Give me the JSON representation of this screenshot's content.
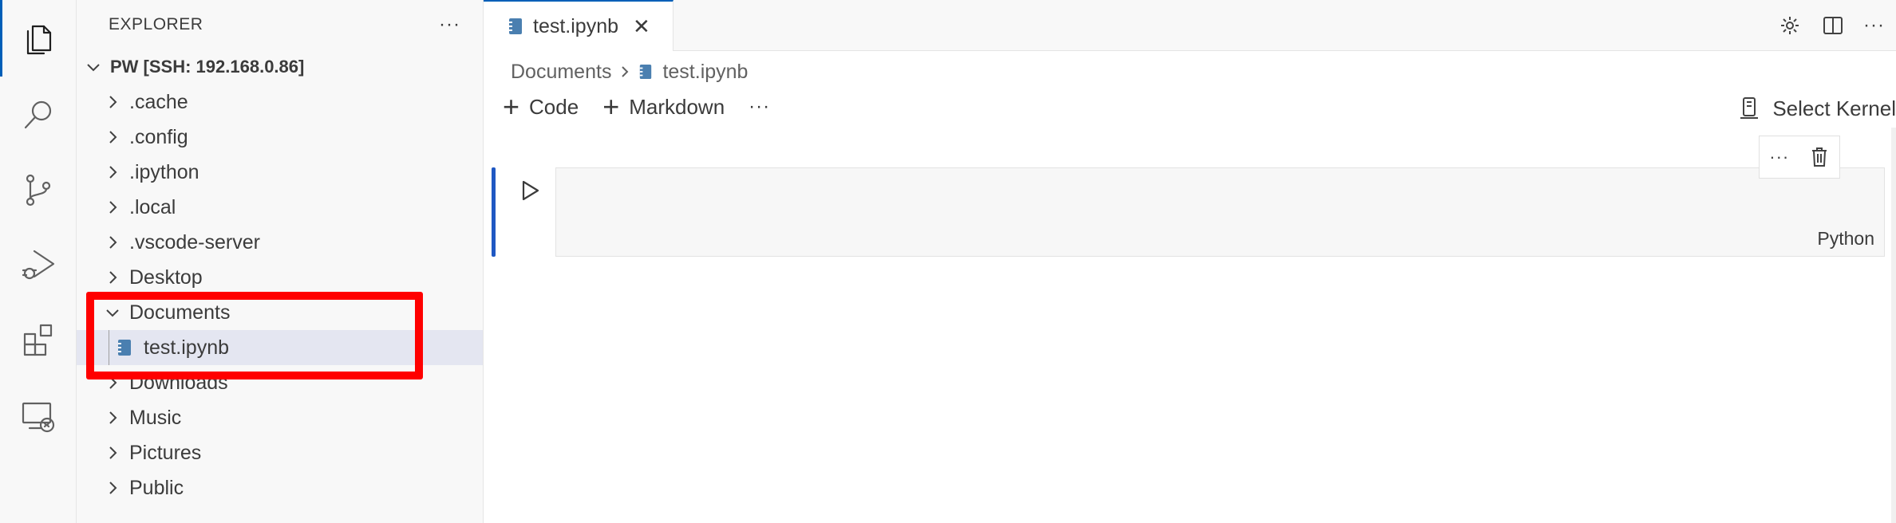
{
  "activity_bar": {
    "items": [
      {
        "icon": "files-icon",
        "active": true
      },
      {
        "icon": "search-icon",
        "active": false
      },
      {
        "icon": "source-control-icon",
        "active": false
      },
      {
        "icon": "run-debug-icon",
        "active": false
      },
      {
        "icon": "extensions-icon",
        "active": false
      },
      {
        "icon": "remote-explorer-icon",
        "active": false
      }
    ]
  },
  "sidebar": {
    "title": "EXPLORER",
    "more": "···",
    "root": "PW [SSH: 192.168.0.86]",
    "items": [
      {
        "label": ".cache",
        "expanded": false
      },
      {
        "label": ".config",
        "expanded": false
      },
      {
        "label": ".ipython",
        "expanded": false
      },
      {
        "label": ".local",
        "expanded": false
      },
      {
        "label": ".vscode-server",
        "expanded": false
      },
      {
        "label": "Desktop",
        "expanded": false
      },
      {
        "label": "Documents",
        "expanded": true
      },
      {
        "label": "test.ipynb",
        "file": true,
        "selected": true
      },
      {
        "label": "Downloads",
        "expanded": false
      },
      {
        "label": "Music",
        "expanded": false
      },
      {
        "label": "Pictures",
        "expanded": false
      },
      {
        "label": "Public",
        "expanded": false
      }
    ]
  },
  "editor": {
    "tab": {
      "label": "test.ipynb",
      "close": "✕"
    },
    "actions_more": "···",
    "breadcrumb": {
      "folder": "Documents",
      "file": "test.ipynb"
    },
    "toolbar": {
      "code_label": "Code",
      "markdown_label": "Markdown",
      "plus": "+",
      "more": "···"
    },
    "kernel_label": "Select Kernel",
    "cell": {
      "language": "Python",
      "more": "···"
    }
  },
  "colors": {
    "accent": "#005fb8",
    "highlight": "#ff0000",
    "cell_focus": "#1f58c3"
  }
}
